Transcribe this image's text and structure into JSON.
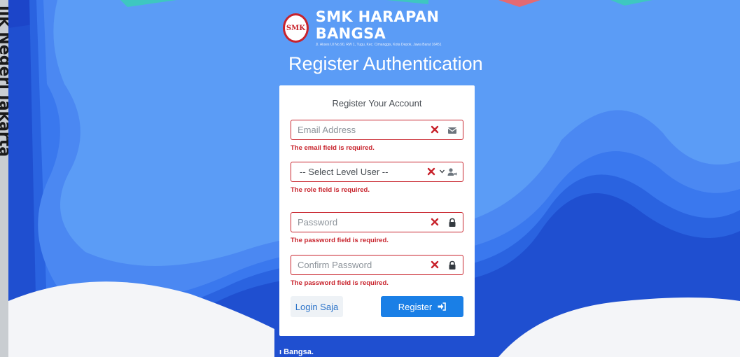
{
  "side_strip": {
    "text": "lik Negeri Jakarta"
  },
  "header": {
    "logo_badge": "SMK",
    "school_name": "SMK HARAPAN BANGSA",
    "school_address": "Jl. Akses UI No.90, RW 1, Tugu, Kec. Cimanggis, Kota Depok, Jawa Barat 16451"
  },
  "page_title": "Register Authentication",
  "form": {
    "title": "Register Your Account",
    "email": {
      "placeholder": "Email Address",
      "error": "The email field is required."
    },
    "role": {
      "selected": "-- Select Level User --",
      "error": "The role field is required."
    },
    "password": {
      "placeholder": "Password",
      "error": "The password field is required."
    },
    "confirm_password": {
      "placeholder": "Confirm Password",
      "error": "The password field is required."
    },
    "login_label": "Login Saja",
    "register_label": "Register"
  },
  "footer": {
    "text": "ı Bangsa."
  },
  "icons": {
    "clear": "x-icon",
    "email": "envelope-icon",
    "role": "user-arrow-icon",
    "password": "lock-icon",
    "register": "sign-in-icon"
  },
  "colors": {
    "accent": "#1a7fe6",
    "error": "#c8232c",
    "bg_light": "#5b9cf6",
    "bg_dark": "#1f4fd0"
  }
}
